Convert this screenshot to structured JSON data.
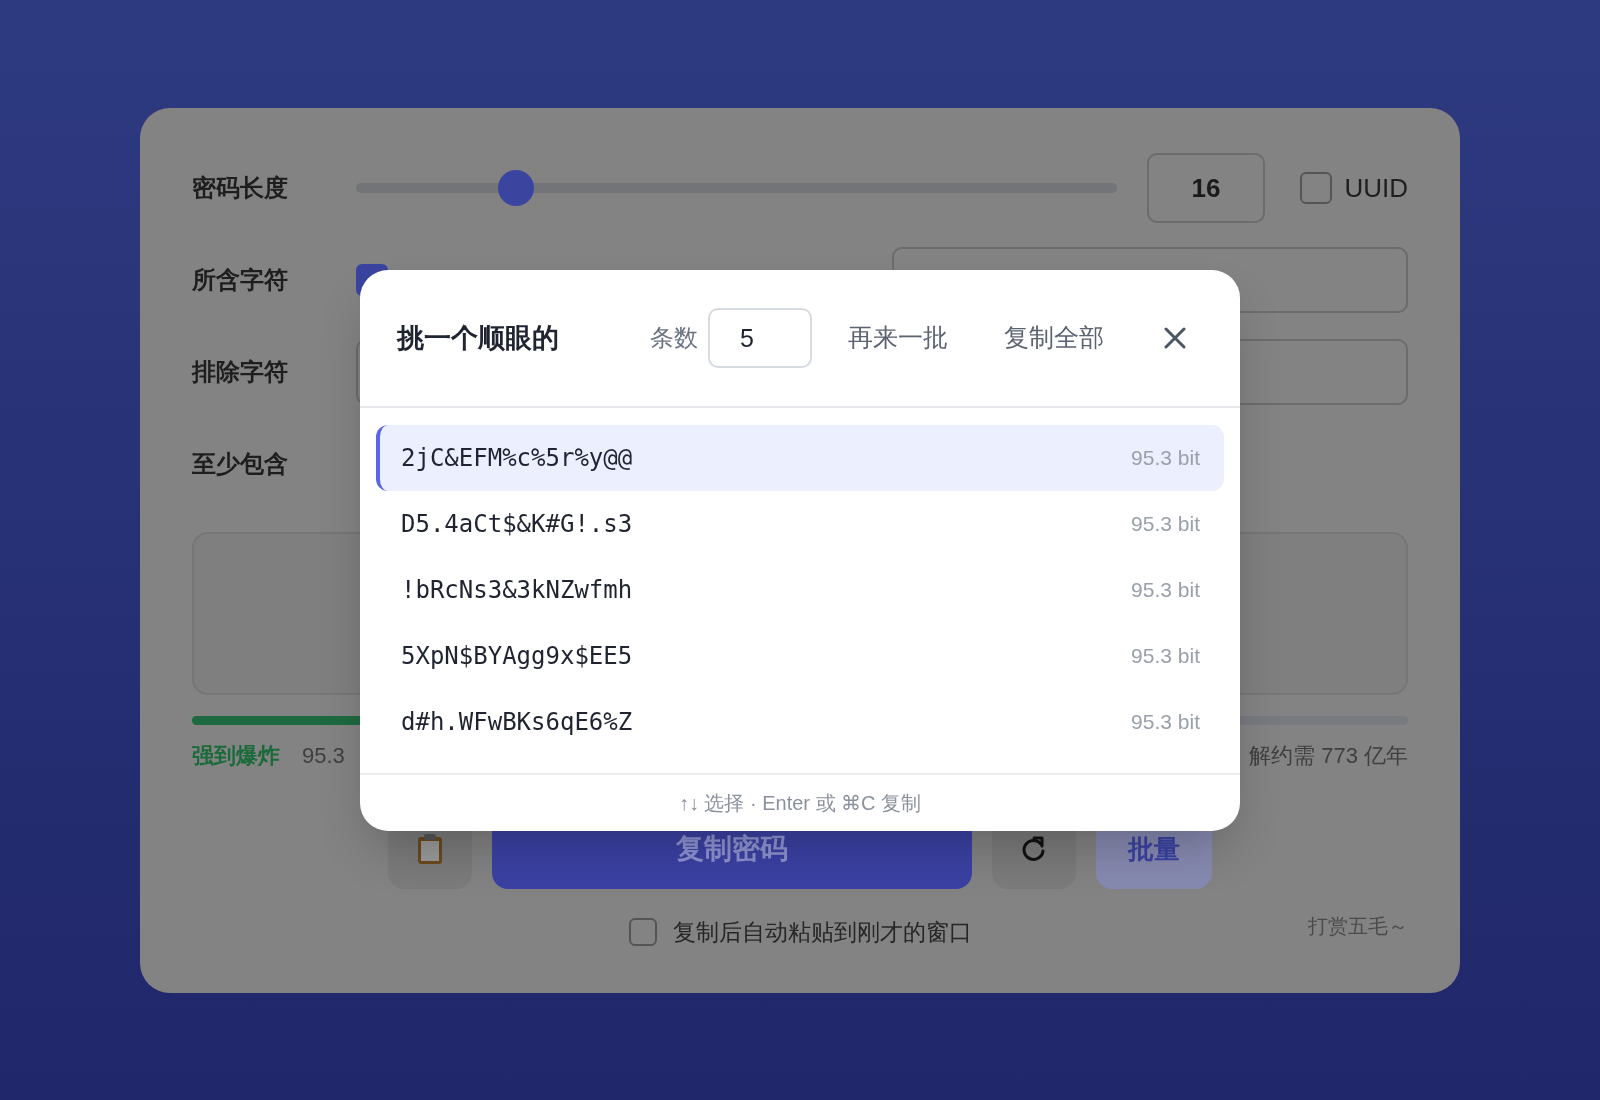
{
  "settings": {
    "length": {
      "label": "密码长度",
      "level": 0.21,
      "value": "16"
    },
    "uuid": {
      "label": "UUID",
      "checked": false
    },
    "charset": {
      "label": "所含字符",
      "options": [
        {
          "checked": true
        }
      ]
    },
    "exclude": {
      "label": "排除字符"
    },
    "require": {
      "label": "至少包含"
    }
  },
  "strength": {
    "label": "强到爆炸",
    "level": 0.5,
    "bits": "95.3",
    "crack_time": "解约需 773 亿年"
  },
  "actions": {
    "copy": "复制密码",
    "batch": "批量"
  },
  "auto_paste": {
    "label": "复制后自动粘贴到刚才的窗口",
    "checked": false
  },
  "tip": "打赏五毛～",
  "picker": {
    "title": "挑一个顺眼的",
    "count_label": "条数",
    "count": "5",
    "buttons": [
      "再来一批",
      "复制全部"
    ],
    "rows": [
      {
        "password": "2jC&EFM%c%5r%y@@",
        "bits": "95.3 bit",
        "selected": true
      },
      {
        "password": "D5.4aCt$&K#G!.s3",
        "bits": "95.3 bit",
        "selected": false
      },
      {
        "password": "!bRcNs3&3kNZwfmh",
        "bits": "95.3 bit",
        "selected": false
      },
      {
        "password": "5XpN$BYAgg9x$EE5",
        "bits": "95.3 bit",
        "selected": false
      },
      {
        "password": "d#h.WFwBKs6qE6%Z",
        "bits": "95.3 bit",
        "selected": false
      }
    ],
    "hint": "↑↓ 选择 · Enter 或 ⌘C 复制"
  }
}
